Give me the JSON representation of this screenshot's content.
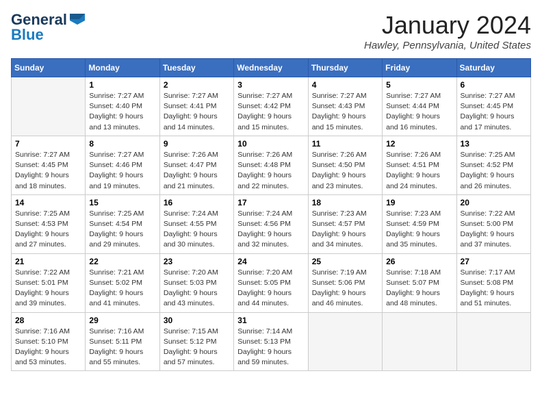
{
  "header": {
    "logo_general": "General",
    "logo_blue": "Blue",
    "month_title": "January 2024",
    "location": "Hawley, Pennsylvania, United States"
  },
  "days_of_week": [
    "Sunday",
    "Monday",
    "Tuesday",
    "Wednesday",
    "Thursday",
    "Friday",
    "Saturday"
  ],
  "weeks": [
    [
      {
        "day": "",
        "sunrise": "",
        "sunset": "",
        "daylight": ""
      },
      {
        "day": "1",
        "sunrise": "Sunrise: 7:27 AM",
        "sunset": "Sunset: 4:40 PM",
        "daylight": "Daylight: 9 hours and 13 minutes."
      },
      {
        "day": "2",
        "sunrise": "Sunrise: 7:27 AM",
        "sunset": "Sunset: 4:41 PM",
        "daylight": "Daylight: 9 hours and 14 minutes."
      },
      {
        "day": "3",
        "sunrise": "Sunrise: 7:27 AM",
        "sunset": "Sunset: 4:42 PM",
        "daylight": "Daylight: 9 hours and 15 minutes."
      },
      {
        "day": "4",
        "sunrise": "Sunrise: 7:27 AM",
        "sunset": "Sunset: 4:43 PM",
        "daylight": "Daylight: 9 hours and 15 minutes."
      },
      {
        "day": "5",
        "sunrise": "Sunrise: 7:27 AM",
        "sunset": "Sunset: 4:44 PM",
        "daylight": "Daylight: 9 hours and 16 minutes."
      },
      {
        "day": "6",
        "sunrise": "Sunrise: 7:27 AM",
        "sunset": "Sunset: 4:45 PM",
        "daylight": "Daylight: 9 hours and 17 minutes."
      }
    ],
    [
      {
        "day": "7",
        "sunrise": "Sunrise: 7:27 AM",
        "sunset": "Sunset: 4:45 PM",
        "daylight": "Daylight: 9 hours and 18 minutes."
      },
      {
        "day": "8",
        "sunrise": "Sunrise: 7:27 AM",
        "sunset": "Sunset: 4:46 PM",
        "daylight": "Daylight: 9 hours and 19 minutes."
      },
      {
        "day": "9",
        "sunrise": "Sunrise: 7:26 AM",
        "sunset": "Sunset: 4:47 PM",
        "daylight": "Daylight: 9 hours and 21 minutes."
      },
      {
        "day": "10",
        "sunrise": "Sunrise: 7:26 AM",
        "sunset": "Sunset: 4:48 PM",
        "daylight": "Daylight: 9 hours and 22 minutes."
      },
      {
        "day": "11",
        "sunrise": "Sunrise: 7:26 AM",
        "sunset": "Sunset: 4:50 PM",
        "daylight": "Daylight: 9 hours and 23 minutes."
      },
      {
        "day": "12",
        "sunrise": "Sunrise: 7:26 AM",
        "sunset": "Sunset: 4:51 PM",
        "daylight": "Daylight: 9 hours and 24 minutes."
      },
      {
        "day": "13",
        "sunrise": "Sunrise: 7:25 AM",
        "sunset": "Sunset: 4:52 PM",
        "daylight": "Daylight: 9 hours and 26 minutes."
      }
    ],
    [
      {
        "day": "14",
        "sunrise": "Sunrise: 7:25 AM",
        "sunset": "Sunset: 4:53 PM",
        "daylight": "Daylight: 9 hours and 27 minutes."
      },
      {
        "day": "15",
        "sunrise": "Sunrise: 7:25 AM",
        "sunset": "Sunset: 4:54 PM",
        "daylight": "Daylight: 9 hours and 29 minutes."
      },
      {
        "day": "16",
        "sunrise": "Sunrise: 7:24 AM",
        "sunset": "Sunset: 4:55 PM",
        "daylight": "Daylight: 9 hours and 30 minutes."
      },
      {
        "day": "17",
        "sunrise": "Sunrise: 7:24 AM",
        "sunset": "Sunset: 4:56 PM",
        "daylight": "Daylight: 9 hours and 32 minutes."
      },
      {
        "day": "18",
        "sunrise": "Sunrise: 7:23 AM",
        "sunset": "Sunset: 4:57 PM",
        "daylight": "Daylight: 9 hours and 34 minutes."
      },
      {
        "day": "19",
        "sunrise": "Sunrise: 7:23 AM",
        "sunset": "Sunset: 4:59 PM",
        "daylight": "Daylight: 9 hours and 35 minutes."
      },
      {
        "day": "20",
        "sunrise": "Sunrise: 7:22 AM",
        "sunset": "Sunset: 5:00 PM",
        "daylight": "Daylight: 9 hours and 37 minutes."
      }
    ],
    [
      {
        "day": "21",
        "sunrise": "Sunrise: 7:22 AM",
        "sunset": "Sunset: 5:01 PM",
        "daylight": "Daylight: 9 hours and 39 minutes."
      },
      {
        "day": "22",
        "sunrise": "Sunrise: 7:21 AM",
        "sunset": "Sunset: 5:02 PM",
        "daylight": "Daylight: 9 hours and 41 minutes."
      },
      {
        "day": "23",
        "sunrise": "Sunrise: 7:20 AM",
        "sunset": "Sunset: 5:03 PM",
        "daylight": "Daylight: 9 hours and 43 minutes."
      },
      {
        "day": "24",
        "sunrise": "Sunrise: 7:20 AM",
        "sunset": "Sunset: 5:05 PM",
        "daylight": "Daylight: 9 hours and 44 minutes."
      },
      {
        "day": "25",
        "sunrise": "Sunrise: 7:19 AM",
        "sunset": "Sunset: 5:06 PM",
        "daylight": "Daylight: 9 hours and 46 minutes."
      },
      {
        "day": "26",
        "sunrise": "Sunrise: 7:18 AM",
        "sunset": "Sunset: 5:07 PM",
        "daylight": "Daylight: 9 hours and 48 minutes."
      },
      {
        "day": "27",
        "sunrise": "Sunrise: 7:17 AM",
        "sunset": "Sunset: 5:08 PM",
        "daylight": "Daylight: 9 hours and 51 minutes."
      }
    ],
    [
      {
        "day": "28",
        "sunrise": "Sunrise: 7:16 AM",
        "sunset": "Sunset: 5:10 PM",
        "daylight": "Daylight: 9 hours and 53 minutes."
      },
      {
        "day": "29",
        "sunrise": "Sunrise: 7:16 AM",
        "sunset": "Sunset: 5:11 PM",
        "daylight": "Daylight: 9 hours and 55 minutes."
      },
      {
        "day": "30",
        "sunrise": "Sunrise: 7:15 AM",
        "sunset": "Sunset: 5:12 PM",
        "daylight": "Daylight: 9 hours and 57 minutes."
      },
      {
        "day": "31",
        "sunrise": "Sunrise: 7:14 AM",
        "sunset": "Sunset: 5:13 PM",
        "daylight": "Daylight: 9 hours and 59 minutes."
      },
      {
        "day": "",
        "sunrise": "",
        "sunset": "",
        "daylight": ""
      },
      {
        "day": "",
        "sunrise": "",
        "sunset": "",
        "daylight": ""
      },
      {
        "day": "",
        "sunrise": "",
        "sunset": "",
        "daylight": ""
      }
    ]
  ]
}
